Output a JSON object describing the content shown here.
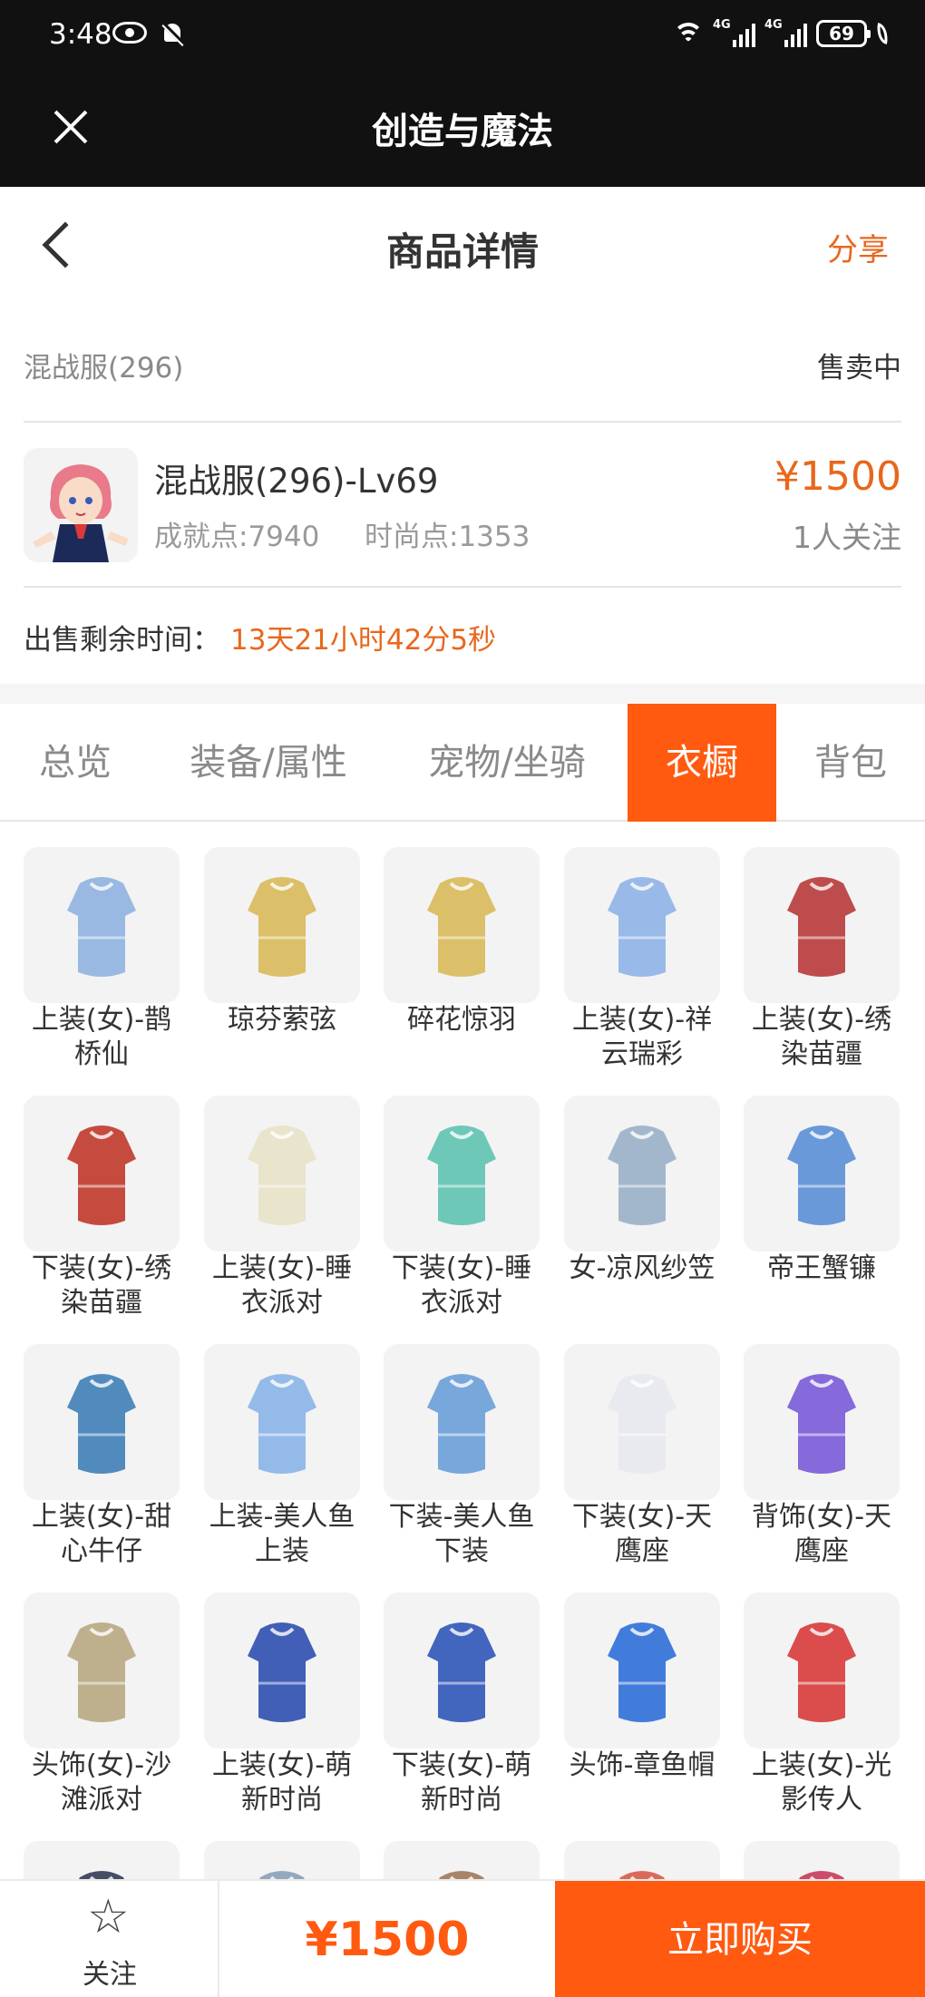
{
  "status_bar": {
    "time": "3:48",
    "battery": "69",
    "net1": "4G",
    "net2": "4G"
  },
  "app_bar": {
    "title": "创造与魔法"
  },
  "header": {
    "title": "商品详情",
    "share": "分享"
  },
  "server": {
    "name": "混战服(296)",
    "status": "售卖中"
  },
  "product": {
    "title": "混战服(296)-Lv69",
    "achievement": "成就点:7940",
    "fashion": "时尚点:1353",
    "price": "¥1500",
    "followers": "1人关注"
  },
  "remaining": {
    "label": "出售剩余时间：",
    "value": "13天21小时42分5秒"
  },
  "tabs": [
    {
      "label": "总览"
    },
    {
      "label": "装备/属性"
    },
    {
      "label": "宠物/坐骑"
    },
    {
      "label": "衣橱",
      "active": true
    },
    {
      "label": "背包"
    }
  ],
  "items": [
    {
      "label": "上装(女)-鹊桥仙",
      "icon": "outfit-dress-icon",
      "color": "#8fb3e0"
    },
    {
      "label": "琼芬萦弦",
      "icon": "golden-bow-icon",
      "color": "#d9b95a"
    },
    {
      "label": "碎花惊羽",
      "icon": "golden-wing-icon",
      "color": "#d9b95a"
    },
    {
      "label": "上装(女)-祥云瑞彩",
      "icon": "outfit-dress-icon",
      "color": "#8fb3e8"
    },
    {
      "label": "上装(女)-绣染苗疆",
      "icon": "outfit-poncho-icon",
      "color": "#b83a3a"
    },
    {
      "label": "下装(女)-绣染苗疆",
      "icon": "skirt-icon",
      "color": "#c0392b"
    },
    {
      "label": "上装(女)-睡衣派对",
      "icon": "pajama-top-icon",
      "color": "#e8e2c8"
    },
    {
      "label": "下装(女)-睡衣派对",
      "icon": "slippers-icon",
      "color": "#5ec3b0"
    },
    {
      "label": "女-凉风纱笠",
      "icon": "veil-hat-icon",
      "color": "#9ab0c8"
    },
    {
      "label": "帝王蟹镰",
      "icon": "scythe-icon",
      "color": "#5a8fd6"
    },
    {
      "label": "上装(女)-甜心牛仔",
      "icon": "denim-jacket-icon",
      "color": "#3f7fb8"
    },
    {
      "label": "上装-美人鱼上装",
      "icon": "mermaid-top-icon",
      "color": "#8ab4e8"
    },
    {
      "label": "下装-美人鱼下装",
      "icon": "mermaid-tail-icon",
      "color": "#6a9fd8"
    },
    {
      "label": "下装(女)-天鹰座",
      "icon": "pants-icon",
      "color": "#e8e8f0"
    },
    {
      "label": "背饰(女)-天鹰座",
      "icon": "backpack-icon",
      "color": "#7a5ad8"
    },
    {
      "label": "头饰(女)-沙滩派对",
      "icon": "sun-hat-icon",
      "color": "#b8a882"
    },
    {
      "label": "上装(女)-萌新时尚",
      "icon": "qipao-top-icon",
      "color": "#2f4fb0"
    },
    {
      "label": "下装(女)-萌新时尚",
      "icon": "wide-pants-icon",
      "color": "#2f55b8"
    },
    {
      "label": "头饰-章鱼帽",
      "icon": "octopus-hat-icon",
      "color": "#2f6fd8"
    },
    {
      "label": "上装(女)-光影传人",
      "icon": "red-jacket-icon",
      "color": "#d83a3a"
    },
    {
      "label": "",
      "icon": "item-icon",
      "color": "#333b55"
    },
    {
      "label": "",
      "icon": "item-icon",
      "color": "#8aa0b8"
    },
    {
      "label": "",
      "icon": "item-icon",
      "color": "#a0785a"
    },
    {
      "label": "",
      "icon": "item-icon",
      "color": "#d85a4a"
    },
    {
      "label": "",
      "icon": "item-icon",
      "color": "#c83a5a"
    }
  ],
  "bottom_bar": {
    "follow_label": "关注",
    "price": "¥1500",
    "buy_label": "立即购买"
  },
  "colors": {
    "accent": "#ff5a10",
    "price": "#e8671c",
    "topbar": "#111111"
  }
}
